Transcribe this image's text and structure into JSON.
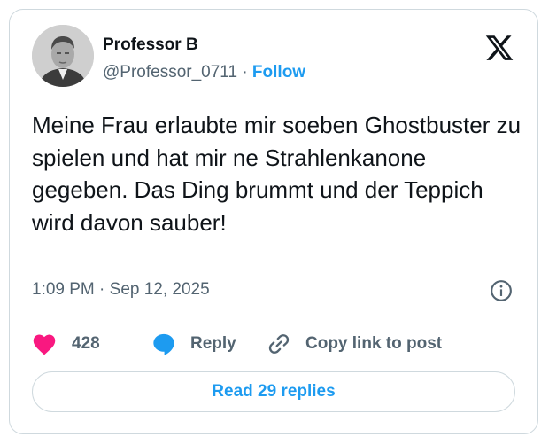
{
  "author": {
    "name": "Professor B",
    "handle": "@Professor_0711",
    "separator": "·",
    "follow_label": "Follow",
    "avatar_icon": "profile-photo"
  },
  "brand": {
    "logo_icon": "x-logo",
    "color": "#0f1419"
  },
  "post": {
    "text": "Meine Frau erlaubte mir soeben Ghostbuster zu spielen und hat mir ne Strahlenkanone gegeben. Das Ding brummt und der Teppich wird davon sauber!",
    "timestamp": "1:09 PM · Sep 12, 2025",
    "info_icon": "info-icon"
  },
  "actions": {
    "like_count": "428",
    "like_color": "#f91880",
    "reply_label": "Reply",
    "reply_color": "#1d9bf0",
    "copy_label": "Copy link to post"
  },
  "footer": {
    "read_replies_label": "Read 29 replies",
    "accent": "#1d9bf0"
  }
}
